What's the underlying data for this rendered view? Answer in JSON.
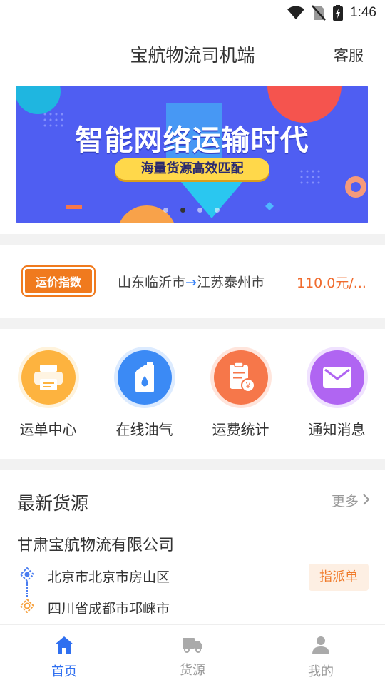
{
  "status_bar": {
    "time": "1:46"
  },
  "header": {
    "title": "宝航物流司机端",
    "service": "客服"
  },
  "banner": {
    "headline": "智能网络运输时代",
    "tagline": "海量货源高效匹配",
    "slide_count": 4,
    "active_slide": 2
  },
  "freight_index": {
    "logo_text": "运价指数",
    "origin": "山东临沂市",
    "arrow": "→",
    "destination": "江苏泰州市",
    "price": "110.0元/..."
  },
  "menu": {
    "items": [
      {
        "label": "运单中心",
        "icon": "printer-icon",
        "color": "#fdb33f"
      },
      {
        "label": "在线油气",
        "icon": "oil-bottle-icon",
        "color": "#3b8af5"
      },
      {
        "label": "运费统计",
        "icon": "receipt-icon",
        "color": "#f6774a"
      },
      {
        "label": "通知消息",
        "icon": "envelope-icon",
        "color": "#b065f2"
      }
    ]
  },
  "latest_cargo": {
    "title": "最新货源",
    "more": "更多",
    "company": "甘肃宝航物流有限公司",
    "from": "北京市北京市房山区",
    "to": "四川省成都市邛崃市",
    "assign_button": "指派单"
  },
  "tab_bar": {
    "tabs": [
      {
        "label": "首页",
        "icon": "home-icon",
        "active": true
      },
      {
        "label": "货源",
        "icon": "truck-icon",
        "active": false
      },
      {
        "label": "我的",
        "icon": "user-icon",
        "active": false
      }
    ]
  },
  "colors": {
    "accent": "#2f6ff0",
    "price": "#f06b2d",
    "banner_bg": "#4f5ef2"
  }
}
